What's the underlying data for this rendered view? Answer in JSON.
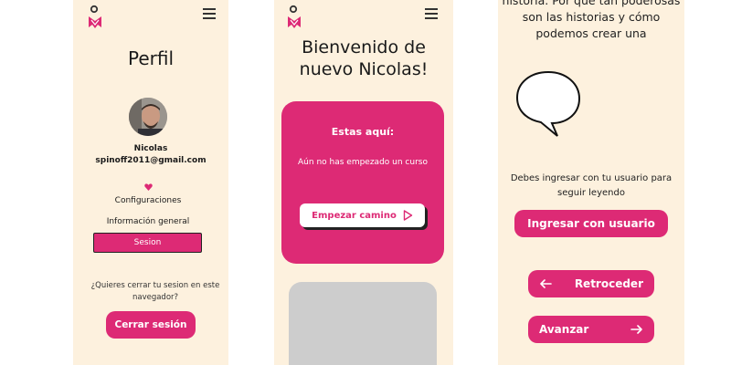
{
  "profile": {
    "title": "Perfil",
    "user_name": "Nicolas",
    "user_email": "spinoff2011@gmail.com",
    "menu": [
      "Configuraciones",
      "Información general"
    ],
    "session_label": "Sesion",
    "logout_question": "¿Quieres cerrar tu sesion en este navegador?",
    "logout_button": "Cerrar sesión"
  },
  "home": {
    "welcome": "Bienvenido de nuevo Nicolas!",
    "card_title": "Estas aquí:",
    "card_text": "Aún no has empezado un curso",
    "start_button": "Empezar camino"
  },
  "story": {
    "text": "historia. Por qué tan poderosas son las historias y cómo podemos crear una",
    "login_message": "Debes ingresar con tu usuario para seguir leyendo",
    "login_button": "Ingresar con usuario",
    "back_button": "Retroceder",
    "next_button": "Avanzar"
  },
  "colors": {
    "background": "#fdf1de",
    "accent": "#dd2a75",
    "placeholder": "#cdcdcd"
  },
  "icons": [
    "logo-icon",
    "hamburger-menu-icon",
    "heart-icon",
    "play-arrow-icon",
    "arrow-left-icon",
    "arrow-right-icon",
    "speech-bubble-icon"
  ]
}
